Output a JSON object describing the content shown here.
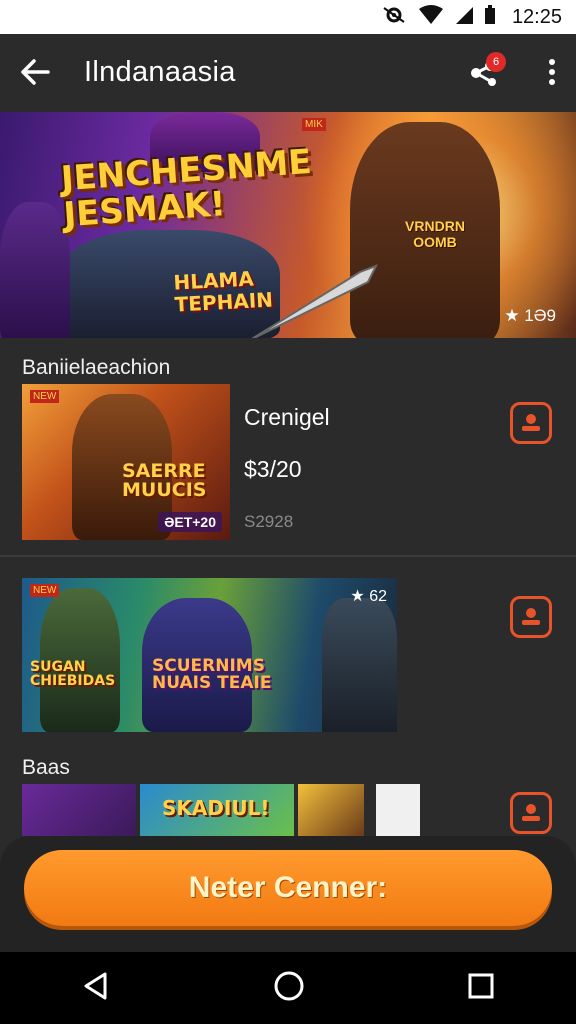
{
  "status_bar": {
    "time": "12:25"
  },
  "app_bar": {
    "title": "Ilndanaasia",
    "badge_count": "6"
  },
  "hero": {
    "title": "JENCHESNME JESMAK!",
    "subtitle": "HLAMA TEPHAIN",
    "corner_tag": "MIK",
    "badge_text": "VRNDRN OOMB",
    "rating": "★ 1Ə9"
  },
  "sections": {
    "first_label": "Baniielaeachion",
    "second_label": "Baas"
  },
  "cards": [
    {
      "title": "Crenigel",
      "price": "$3/20",
      "old_price": "S2928",
      "thumb_text": "SAERRE MUUCIS",
      "thumb_price": "ƏET+20",
      "flag": "NEW"
    },
    {
      "thumb_text": "SCUERNIMS NUAIS TEAIE",
      "thumb_side": "SUGAN CHIEBIDAS",
      "rating": "★ 62",
      "flag": "NEW"
    }
  ],
  "bottom_thumbs": [
    {
      "label": ""
    },
    {
      "label": "SKADIUL!"
    },
    {
      "label": ""
    },
    {
      "label": ""
    }
  ],
  "cta": {
    "label": "Neter Cenner:"
  },
  "colors": {
    "accent": "#f27a12",
    "button_outline": "#e8532a",
    "background": "#2b2b2b"
  }
}
